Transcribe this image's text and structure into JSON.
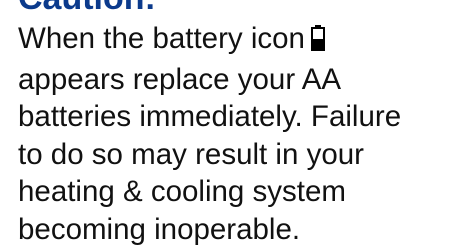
{
  "caution": {
    "heading": "Caution:",
    "lines": [
      "When the battery icon",
      "appears replace your AA",
      "batteries immediately. Failure",
      "to do so may result in your",
      "heating & cooling system",
      "becoming inoperable."
    ],
    "battery_icon": "battery-low-icon",
    "heading_color": "#0b3a8c",
    "text_color": "#111111"
  }
}
